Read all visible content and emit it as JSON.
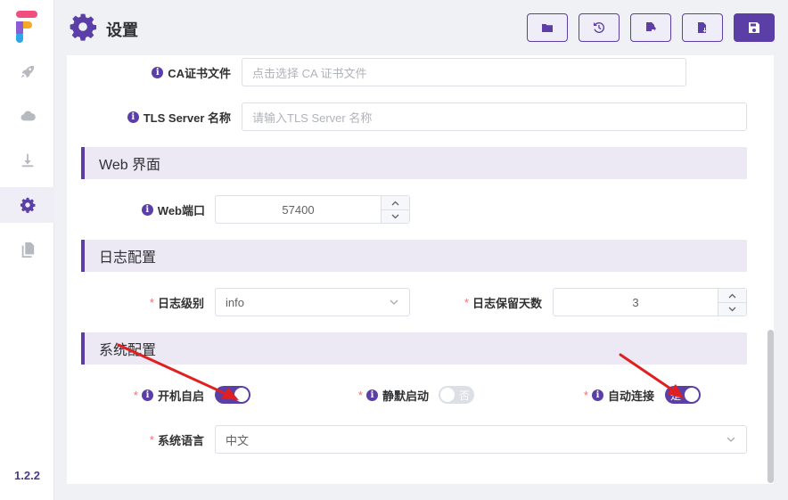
{
  "app": {
    "title": "设置",
    "version": "1.2.2"
  },
  "sidebar": {
    "items": [
      {
        "icon": "rocket-icon"
      },
      {
        "icon": "cloud-icon"
      },
      {
        "icon": "download-icon"
      },
      {
        "icon": "gear-icon",
        "active": true
      },
      {
        "icon": "file-icon"
      }
    ]
  },
  "toolbar": {
    "buttons": [
      "folder-icon",
      "history-icon",
      "file-export-icon",
      "file-import-icon",
      "save-icon"
    ]
  },
  "form": {
    "ca_cert": {
      "label": "CA证书文件",
      "placeholder": "点击选择 CA 证书文件"
    },
    "tls_server": {
      "label": "TLS Server 名称",
      "placeholder": "请输入TLS Server 名称"
    },
    "web_section": {
      "title": "Web 界面"
    },
    "web_port": {
      "label": "Web端口",
      "value": "57400"
    },
    "log_section": {
      "title": "日志配置"
    },
    "log_level": {
      "label": "日志级别",
      "value": "info"
    },
    "log_days": {
      "label": "日志保留天数",
      "value": "3"
    },
    "system_section": {
      "title": "系统配置"
    },
    "autostart": {
      "label": "开机自启",
      "on": true,
      "text": ""
    },
    "silent_start": {
      "label": "静默启动",
      "on": false,
      "text": "否"
    },
    "auto_connect": {
      "label": "自动连接",
      "on": true,
      "text": "是"
    },
    "language": {
      "label": "系统语言",
      "value": "中文"
    }
  },
  "colors": {
    "accent": "#5b3fa6",
    "required": "#f56c6c",
    "annotation_arrow": "#e02020"
  }
}
